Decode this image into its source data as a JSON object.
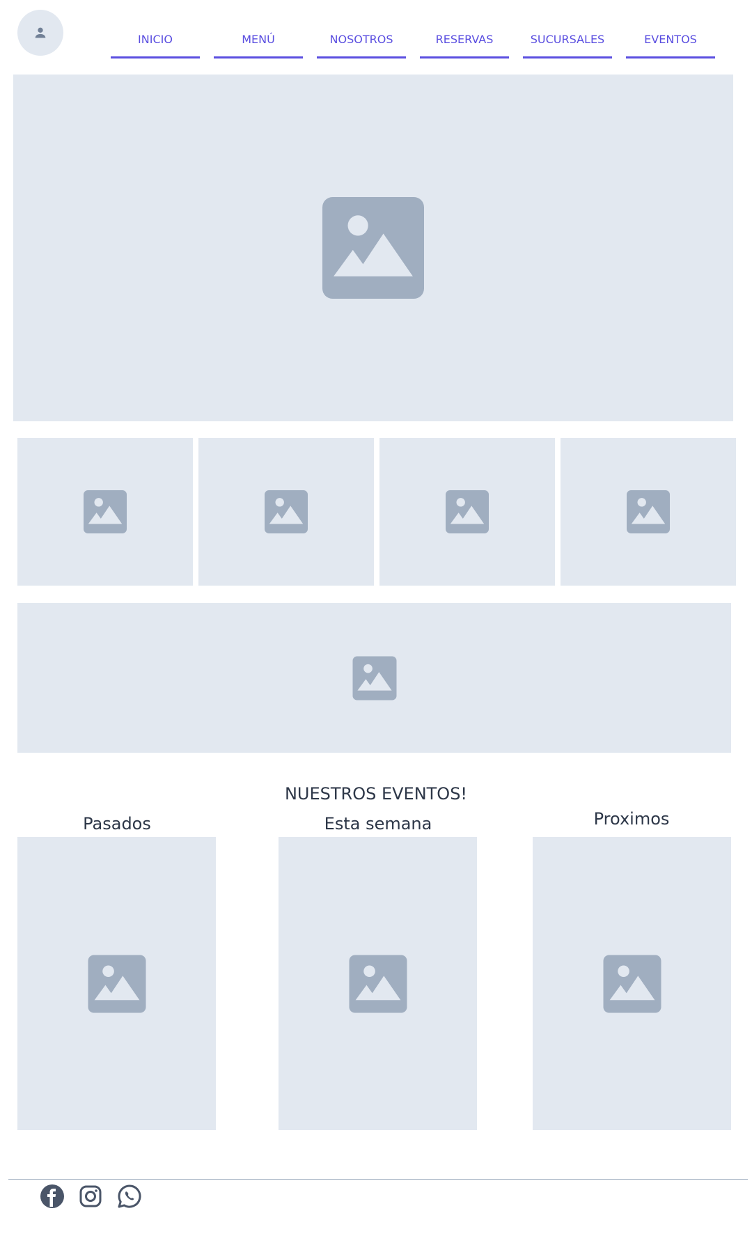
{
  "nav": {
    "items": [
      {
        "label": "INICIO"
      },
      {
        "label": "MENÚ"
      },
      {
        "label": "NOSOTROS"
      },
      {
        "label": "RESERVAS"
      },
      {
        "label": "SUCURSALES"
      },
      {
        "label": "EVENTOS"
      }
    ]
  },
  "events": {
    "title": "NUESTROS EVENTOS!",
    "columns": [
      {
        "label": "Pasados"
      },
      {
        "label": "Esta semana"
      },
      {
        "label": "Proximos"
      }
    ]
  },
  "footer": {
    "icons": [
      "facebook-icon",
      "instagram-icon",
      "whatsapp-icon"
    ]
  },
  "colors": {
    "accent": "#5a4ee0",
    "placeholder_bg": "#e2e8f0",
    "placeholder_icon": "#a0aec0",
    "text": "#2d3748"
  }
}
